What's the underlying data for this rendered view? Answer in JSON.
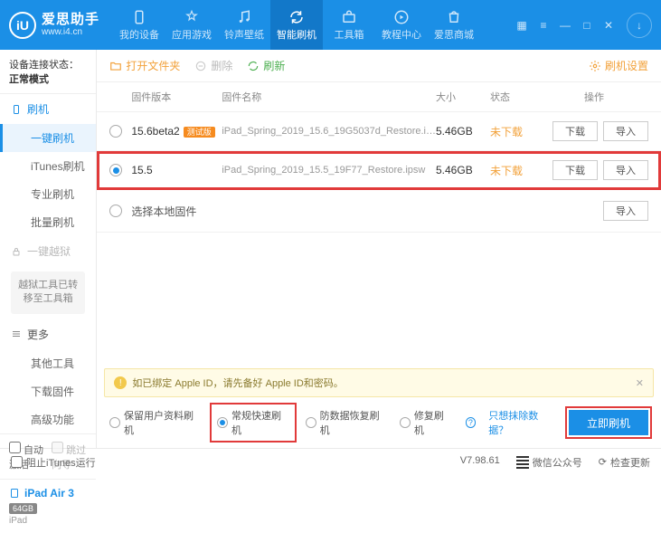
{
  "brand": {
    "cn": "爱思助手",
    "en": "www.i4.cn",
    "logo_letter": "iU"
  },
  "nav": [
    {
      "label": "我的设备"
    },
    {
      "label": "应用游戏"
    },
    {
      "label": "铃声壁纸"
    },
    {
      "label": "智能刷机"
    },
    {
      "label": "工具箱"
    },
    {
      "label": "教程中心"
    },
    {
      "label": "爱思商城"
    }
  ],
  "conn_status": {
    "prefix": "设备连接状态：",
    "value": "正常模式"
  },
  "sidebar": {
    "group_flash": "刷机",
    "items_flash": [
      "一键刷机",
      "iTunes刷机",
      "专业刷机",
      "批量刷机"
    ],
    "group_jb": "一键越狱",
    "jb_note": "越狱工具已转移至工具箱",
    "group_more": "更多",
    "items_more": [
      "其他工具",
      "下载固件",
      "高级功能"
    ],
    "auto_activate": "自动激活",
    "skip_guide": "跳过向导",
    "device_name": "iPad Air 3",
    "device_storage": "64GB",
    "device_type": "iPad"
  },
  "toolbar": {
    "open_folder": "打开文件夹",
    "delete": "删除",
    "refresh": "刷新",
    "settings": "刷机设置"
  },
  "table": {
    "h_version": "固件版本",
    "h_name": "固件名称",
    "h_size": "大小",
    "h_status": "状态",
    "h_ops": "操作",
    "btn_download": "下载",
    "btn_import": "导入",
    "rows": [
      {
        "version": "15.6beta2",
        "tag": "测试版",
        "name": "iPad_Spring_2019_15.6_19G5037d_Restore.i…",
        "size": "5.46GB",
        "status": "未下载",
        "selected": false
      },
      {
        "version": "15.5",
        "tag": "",
        "name": "iPad_Spring_2019_15.5_19F77_Restore.ipsw",
        "size": "5.46GB",
        "status": "未下载",
        "selected": true
      }
    ],
    "local_label": "选择本地固件"
  },
  "notice": "如已绑定 Apple ID，请先备好 Apple ID和密码。",
  "modes": {
    "keep_data": "保留用户资料刷机",
    "normal": "常规快速刷机",
    "anti_recover": "防数据恢复刷机",
    "repair": "修复刷机",
    "exclude_link": "只想抹除数据？",
    "flash_btn": "立即刷机"
  },
  "statusbar": {
    "block_itunes": "阻止iTunes运行",
    "version": "V7.98.61",
    "wechat": "微信公众号",
    "check_update": "检查更新"
  }
}
